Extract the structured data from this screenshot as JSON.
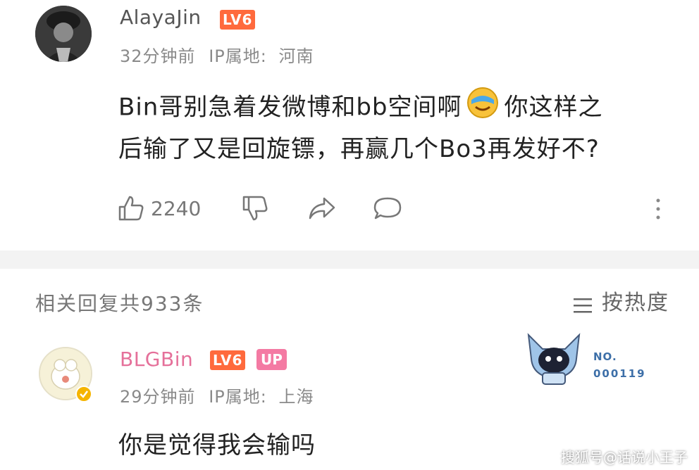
{
  "comment": {
    "username": "AlayaJin",
    "level": "LV6",
    "time": "32分钟前",
    "ip_label": "IP属地:",
    "ip_location": "河南",
    "text_line1_a": "Bin哥别急着发微博和bb空间啊",
    "text_line1_b": "你这样之",
    "text_line2": "后输了又是回旋镖，再赢几个Bo3再发好不?",
    "like_count": "2240"
  },
  "replies_header": {
    "count_text": "相关回复共933条",
    "sort_label": "按热度"
  },
  "reply": {
    "username": "BLGBin",
    "level": "LV6",
    "badge": "UP",
    "time": "29分钟前",
    "ip_label": "IP属地:",
    "ip_location": "上海",
    "text": "你是觉得我会输吗",
    "decoration_no": "NO.",
    "decoration_num": "000119"
  },
  "watermark": "搜狐号@话说小王子",
  "colors": {
    "level_badge": "#ff6a3d",
    "up_badge": "#f47aa3",
    "up_name": "#e5709a"
  }
}
